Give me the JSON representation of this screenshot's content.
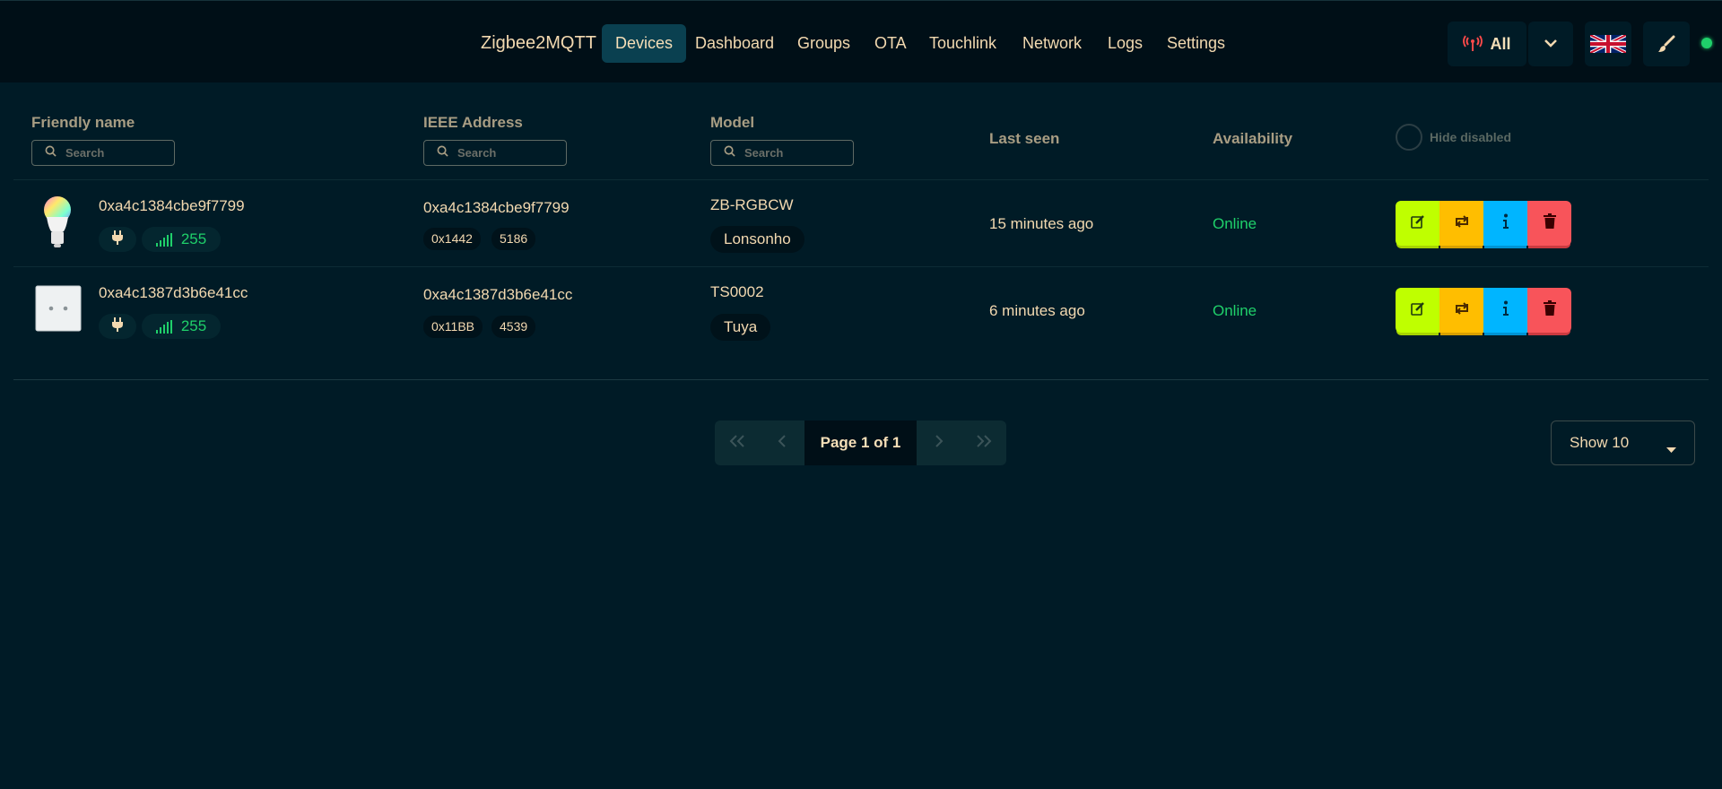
{
  "navbar": {
    "brand": "Zigbee2MQTT",
    "items": [
      {
        "label": "Devices",
        "active": true
      },
      {
        "label": "Dashboard"
      },
      {
        "label": "Groups"
      },
      {
        "label": "OTA"
      },
      {
        "label": "Touchlink"
      },
      {
        "label": "Network"
      },
      {
        "label": "Logs"
      },
      {
        "label": "Settings"
      }
    ],
    "permit_join_label": "All",
    "permit_join_icon": "antenna-icon",
    "language_icon": "uk-flag-icon",
    "theme_icon": "paintbrush-icon",
    "status_color": "#1fd06a"
  },
  "table": {
    "headers": {
      "friendly_name": "Friendly name",
      "ieee": "IEEE Address",
      "model": "Model",
      "last_seen": "Last seen",
      "availability": "Availability"
    },
    "search_placeholder": "Search",
    "hide_disabled_label": "Hide disabled",
    "rows": [
      {
        "friendly_name": "0xa4c1384cbe9f7799",
        "image": "bulb-icon",
        "power_icon": "plug-icon",
        "lqi": "255",
        "ieee": "0xa4c1384cbe9f7799",
        "nwk": "0x1442",
        "nwk_dec": "5186",
        "model": "ZB-RGBCW",
        "vendor": "Lonsonho",
        "last_seen": "15 minutes ago",
        "availability": "Online"
      },
      {
        "friendly_name": "0xa4c1387d3b6e41cc",
        "image": "switch-icon",
        "power_icon": "plug-icon",
        "lqi": "255",
        "ieee": "0xa4c1387d3b6e41cc",
        "nwk": "0x11BB",
        "nwk_dec": "4539",
        "model": "TS0002",
        "vendor": "Tuya",
        "last_seen": "6 minutes ago",
        "availability": "Online"
      }
    ]
  },
  "pagination": {
    "label": "Page 1 of 1",
    "page_size": "Show 10"
  },
  "colors": {
    "background": "#001b26",
    "online": "#1fd06a",
    "edit": "#bfff00",
    "rename": "#ffbe00",
    "info": "#00b5ff",
    "delete": "#f8545a"
  }
}
